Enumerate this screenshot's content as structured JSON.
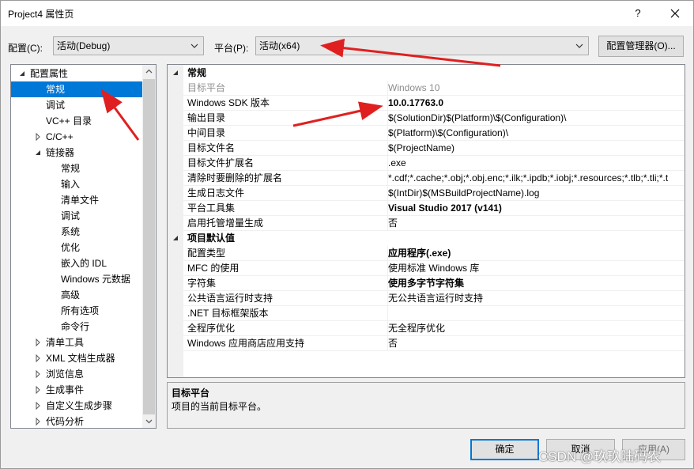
{
  "window": {
    "title": "Project4 属性页",
    "help": "?"
  },
  "toolbar": {
    "config_label": "配置(C):",
    "config_value": "活动(Debug)",
    "platform_label": "平台(P):",
    "platform_value": "活动(x64)",
    "config_manager": "配置管理器(O)..."
  },
  "tree": {
    "items": [
      {
        "label": "配置属性",
        "expanded": true
      },
      {
        "label": "常规",
        "selected": true
      },
      {
        "label": "调试"
      },
      {
        "label": "VC++ 目录"
      },
      {
        "label": "C/C++",
        "collapsed": true
      },
      {
        "label": "链接器",
        "expanded": true
      },
      {
        "label": "常规"
      },
      {
        "label": "输入"
      },
      {
        "label": "清单文件"
      },
      {
        "label": "调试"
      },
      {
        "label": "系统"
      },
      {
        "label": "优化"
      },
      {
        "label": "嵌入的 IDL"
      },
      {
        "label": "Windows 元数据"
      },
      {
        "label": "高级"
      },
      {
        "label": "所有选项"
      },
      {
        "label": "命令行"
      },
      {
        "label": "清单工具",
        "collapsed": true
      },
      {
        "label": "XML 文档生成器",
        "collapsed": true
      },
      {
        "label": "浏览信息",
        "collapsed": true
      },
      {
        "label": "生成事件",
        "collapsed": true
      },
      {
        "label": "自定义生成步骤",
        "collapsed": true
      },
      {
        "label": "代码分析",
        "collapsed": true
      }
    ]
  },
  "grid": {
    "categories": [
      {
        "label": "常规",
        "rows": [
          {
            "name": "目标平台",
            "value": "Windows 10",
            "disabled": true
          },
          {
            "name": "Windows SDK 版本",
            "value": "10.0.17763.0",
            "bold": true
          },
          {
            "name": "输出目录",
            "value": "$(SolutionDir)$(Platform)\\$(Configuration)\\"
          },
          {
            "name": "中间目录",
            "value": "$(Platform)\\$(Configuration)\\"
          },
          {
            "name": "目标文件名",
            "value": "$(ProjectName)"
          },
          {
            "name": "目标文件扩展名",
            "value": ".exe"
          },
          {
            "name": "清除时要删除的扩展名",
            "value": "*.cdf;*.cache;*.obj;*.obj.enc;*.ilk;*.ipdb;*.iobj;*.resources;*.tlb;*.tli;*.t"
          },
          {
            "name": "生成日志文件",
            "value": "$(IntDir)$(MSBuildProjectName).log"
          },
          {
            "name": "平台工具集",
            "value": "Visual Studio 2017 (v141)",
            "bold": true
          },
          {
            "name": "启用托管增量生成",
            "value": "否"
          }
        ]
      },
      {
        "label": "项目默认值",
        "rows": [
          {
            "name": "配置类型",
            "value": "应用程序(.exe)",
            "bold": true
          },
          {
            "name": "MFC 的使用",
            "value": "使用标准 Windows 库"
          },
          {
            "name": "字符集",
            "value": "使用多字节字符集",
            "bold": true
          },
          {
            "name": "公共语言运行时支持",
            "value": "无公共语言运行时支持"
          },
          {
            "name": ".NET 目标框架版本",
            "value": ""
          },
          {
            "name": "全程序优化",
            "value": "无全程序优化"
          },
          {
            "name": "Windows 应用商店应用支持",
            "value": "否"
          }
        ]
      }
    ]
  },
  "description": {
    "title": "目标平台",
    "text": "项目的当前目标平台。"
  },
  "buttons": {
    "ok": "确定",
    "cancel": "取消",
    "apply": "应用(A)"
  },
  "watermark": "CSDN @玖玖陆码农",
  "colors": {
    "selection": "#0078d7",
    "annotation_arrow": "#e02020"
  }
}
